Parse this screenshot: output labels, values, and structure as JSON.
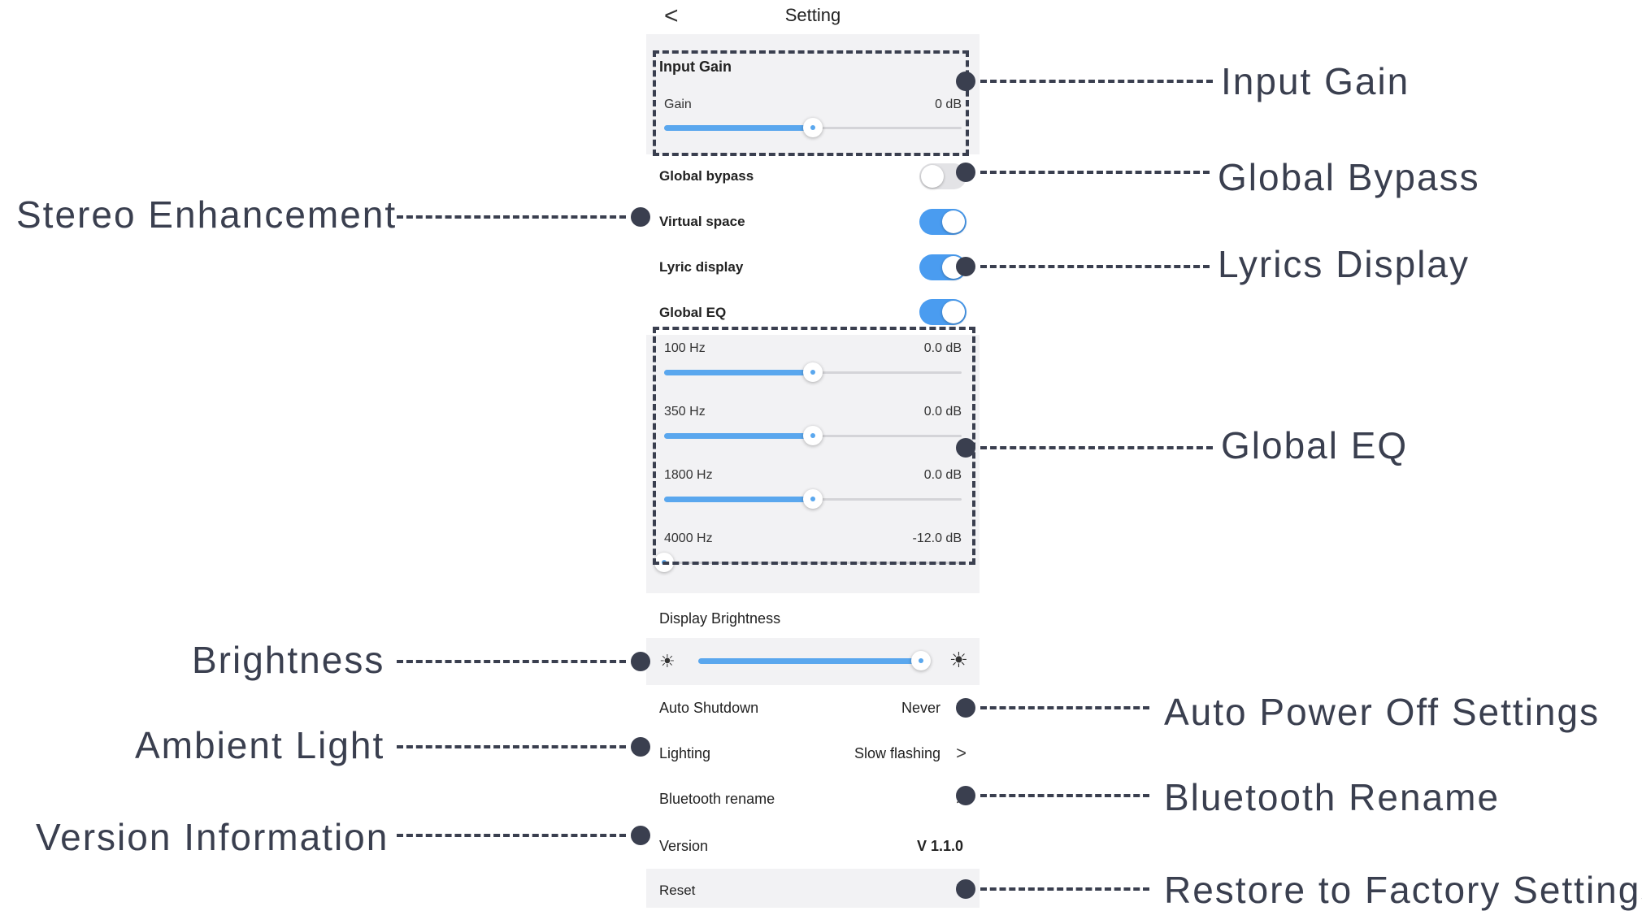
{
  "header": {
    "back": "<",
    "title": "Setting"
  },
  "input_gain": {
    "section_title": "Input Gain",
    "label": "Gain",
    "value": "0 dB",
    "level": 0.5
  },
  "toggles": [
    {
      "label": "Global bypass",
      "state": "off"
    },
    {
      "label": "Virtual space",
      "state": "on"
    },
    {
      "label": "Lyric display",
      "state": "on"
    },
    {
      "label": "Global EQ",
      "state": "on"
    }
  ],
  "eq_bands": [
    {
      "label": "100 Hz",
      "value": "0.0 dB",
      "level": 0.5
    },
    {
      "label": "350 Hz",
      "value": "0.0 dB",
      "level": 0.5
    },
    {
      "label": "1800 Hz",
      "value": "0.0 dB",
      "level": 0.5
    },
    {
      "label": "4000 Hz",
      "value": "-12.0 dB",
      "level": 0.0
    }
  ],
  "brightness": {
    "section_title": "Display Brightness",
    "level": 0.97,
    "icon_low": "sun-small-icon",
    "icon_high": "sun-large-icon"
  },
  "settings": [
    {
      "label": "Auto Shutdown",
      "value": "Never",
      "chevron": ">"
    },
    {
      "label": "Lighting",
      "value": "Slow flashing",
      "chevron": ">"
    },
    {
      "label": "Bluetooth rename",
      "value": "",
      "chevron": ">"
    },
    {
      "label": "Version",
      "value": "V 1.1.0",
      "chevron": ""
    },
    {
      "label": "Reset",
      "value": "",
      "chevron": ">"
    }
  ],
  "callouts": {
    "input_gain": "Input Gain",
    "global_bypass": "Global Bypass",
    "stereo": "Stereo Enhancement",
    "lyrics": "Lyrics Display",
    "global_eq": "Global EQ",
    "brightness": "Brightness",
    "auto_power": "Auto Power Off Settings",
    "ambient": "Ambient Light",
    "bt_rename": "Bluetooth Rename",
    "version": "Version Information",
    "restore": "Restore to Factory Settings"
  },
  "colors": {
    "accent": "#4a9cf0",
    "annotation": "#3a3f4f",
    "section_bg": "#f2f2f4"
  }
}
